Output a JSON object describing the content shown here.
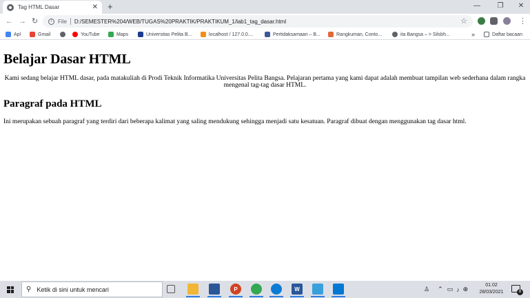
{
  "browser": {
    "tab": {
      "title": "Tag HTML Dasar",
      "close": "✕"
    },
    "new_tab": "+",
    "window_controls": {
      "minimize": "—",
      "restore": "❐",
      "close": "✕"
    },
    "nav": {
      "back": "←",
      "forward": "→",
      "reload": "↻"
    },
    "omnibox": {
      "scheme_label": "File",
      "url": "D:/SEMESTER%204/WEB/TUGAS%20PRAKTIK/PRAKTIKUM_1/lab1_tag_dasar.html",
      "bookmark_star": "☆"
    },
    "menu": "⋮",
    "bookmarks": [
      {
        "label": "Apl",
        "icon": "apps-grid-icon",
        "color": "#4285f4"
      },
      {
        "label": "Gmail",
        "icon": "gmail-icon",
        "color": "#ea4335"
      },
      {
        "label": "",
        "icon": "globe-icon",
        "color": "#5f6368"
      },
      {
        "label": "YouTube",
        "icon": "youtube-icon",
        "color": "#ff0000"
      },
      {
        "label": "Maps",
        "icon": "maps-icon",
        "color": "#34a853"
      },
      {
        "label": "Universitas Pelita B...",
        "icon": "university-icon",
        "color": "#1a3d8f"
      },
      {
        "label": "localhost / 127.0.0....",
        "icon": "phpmyadmin-icon",
        "color": "#f29111"
      },
      {
        "label": "Pertidaksamaan – B...",
        "icon": "page-icon",
        "color": "#3b5998"
      },
      {
        "label": "Rangkuman, Conto...",
        "icon": "page-icon",
        "color": "#e2673a"
      },
      {
        "label": "ita Bangsa – > Silsbh...",
        "icon": "globe-icon",
        "color": "#5f6368"
      }
    ],
    "bookmarks_more": "»",
    "reading_list": "Daftar bacaan"
  },
  "page": {
    "heading": "Belajar Dasar HTML",
    "intro": "Kami sedang belajar HTML dasar, pada matakuliah di Prodi Teknik Informatika Universitas Pelita Bangsa. Pelajaran pertama yang kami dapat adalah membuat tampilan web sederhana dalam rangka mengenal tag-tag dasar HTML.",
    "subheading": "Paragraf pada HTML",
    "paragraph": "Ini merupakan sebuah paragraf yang terdiri dari beberapa kalimat yang saling mendukung sehingga menjadi satu kesatuan. Paragraf dibuat dengan menggunakan tag dasar html."
  },
  "taskbar": {
    "search_placeholder": "Ketik di sini untuk mencari",
    "apps": [
      {
        "name": "task-view-icon",
        "color": "#dce0e6"
      },
      {
        "name": "file-explorer-icon",
        "color": "#f2b636"
      },
      {
        "name": "store-icon",
        "color": "#2b5797"
      },
      {
        "name": "powerpoint-icon",
        "color": "#d04423"
      },
      {
        "name": "chrome-icon",
        "color": "#34a853"
      },
      {
        "name": "edge-icon",
        "color": "#0c7cd5"
      },
      {
        "name": "word-icon",
        "color": "#2b579a"
      },
      {
        "name": "monitor-icon",
        "color": "#3aa0dc"
      },
      {
        "name": "vscode-icon",
        "color": "#0078d4"
      }
    ],
    "clock": {
      "time": "01.02",
      "date": "28/03/2021"
    },
    "notification_count": "8"
  }
}
